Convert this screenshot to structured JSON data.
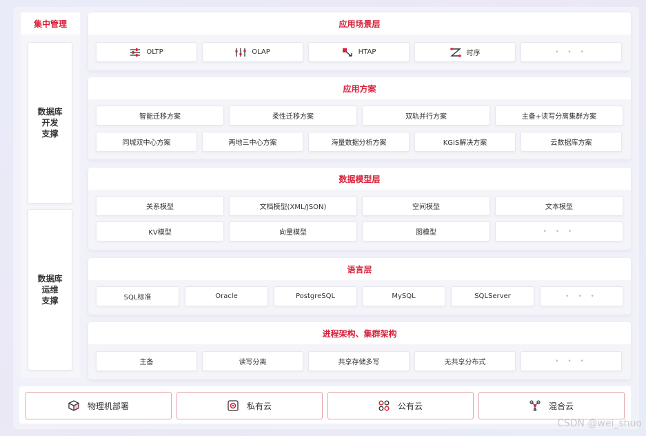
{
  "left": {
    "header": "集中管理",
    "dev": [
      "数据库",
      "开发",
      "支撑"
    ],
    "ops": [
      "数据库",
      "运维",
      "支撑"
    ]
  },
  "layers": {
    "scene": {
      "title": "应用场景层",
      "items": [
        "OLTP",
        "OLAP",
        "HTAP",
        "时序",
        "• • •"
      ]
    },
    "solution": {
      "title": "应用方案",
      "row1": [
        "智能迁移方案",
        "柔性迁移方案",
        "双轨并行方案",
        "主备+读写分离集群方案"
      ],
      "row2": [
        "同城双中心方案",
        "两地三中心方案",
        "海量数据分析方案",
        "KGIS解决方案",
        "云数据库方案"
      ]
    },
    "model": {
      "title": "数据模型层",
      "row1": [
        "关系模型",
        "文档模型(XML/JSON)",
        "空间模型",
        "文本模型"
      ],
      "row2": [
        "KV模型",
        "向量模型",
        "图模型",
        "• • •"
      ]
    },
    "language": {
      "title": "语言层",
      "items": [
        "SQL标准",
        "Oracle",
        "PostgreSQL",
        "MySQL",
        "SQLServer",
        "• • •"
      ]
    },
    "process": {
      "title": "进程架构、集群架构",
      "items": [
        "主备",
        "读写分离",
        "共享存储多写",
        "无共享分布式",
        "• • •"
      ]
    }
  },
  "deploy": [
    "物理机部署",
    "私有云",
    "公有云",
    "混合云"
  ],
  "icons": {
    "oltp": "sliders-icon",
    "olap": "equalizer-icon",
    "htap": "htap-icon",
    "timeseries": "timeseries-icon",
    "physical": "cube-icon",
    "private": "private-cloud-icon",
    "public": "public-cloud-icon",
    "hybrid": "hybrid-cloud-icon"
  },
  "colors": {
    "accent": "#d7223a",
    "border": "#e5a3ad"
  },
  "watermark": "CSDN @wei_shuo"
}
